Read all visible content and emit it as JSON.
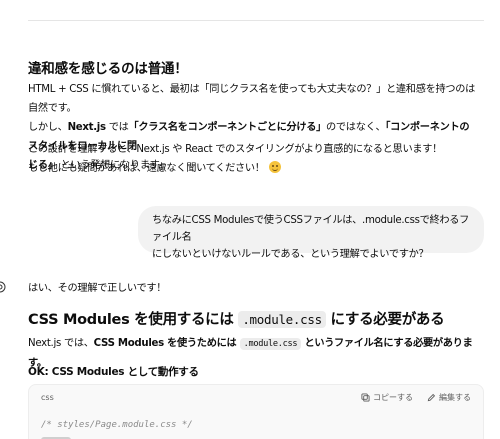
{
  "section1": {
    "heading": "違和感を感じるのは普通！",
    "para1": {
      "line1": "HTML + CSS に慣れていると、最初は「同じクラス名を使っても大丈夫なの？」と違和感を持つのは自然です。",
      "line2a": "しかし、",
      "line2b": "Next.js",
      "line2c": " では",
      "line2d": "「クラス名をコンポーネントごとに分ける」",
      "line2e": "のではなく、",
      "line2f": "「コンポーネントのスタイルをローカルに閉",
      "line3a": "じる」",
      "line3b": " という発想になります。"
    },
    "para2": {
      "line1": "この設計を理解すると、Next.js や React でのスタイリングがより直感的になると思います！",
      "line2": "もし他にも疑問があれば、遠慮なく聞いてください！"
    }
  },
  "user_message": {
    "line1": "ちなみにCSS Modulesで使うCSSファイルは、.module.cssで終わるファイル名",
    "line2": "にしないといけないルールである、という理解でよいですか？"
  },
  "assistant": {
    "intro": "はい、その理解で正しいです！",
    "heading_a": "CSS Modules を使用するには ",
    "heading_code": ".module.css",
    "heading_b": " にする必要がある",
    "para_a": "Next.js では、",
    "para_b": "CSS Modules を使うためには ",
    "para_code": ".module.css",
    "para_c": " というファイル名にする必要があります。",
    "subheading": "OK: CSS Modules として動作する",
    "code": {
      "lang": "css",
      "copy_label": "コピーする",
      "edit_label": "編集する",
      "line1": "/* styles/Page.module.css */"
    }
  }
}
